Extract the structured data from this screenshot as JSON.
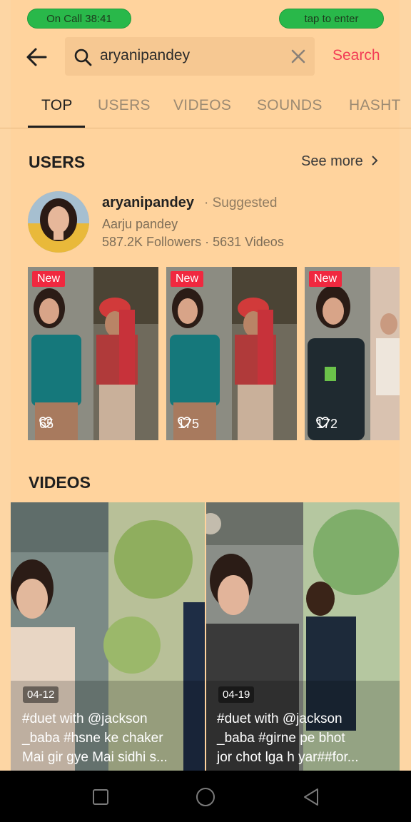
{
  "status": {
    "call_label": "On Call   38:41",
    "enter_label": "tap to enter"
  },
  "search": {
    "query": "aryanipandey",
    "button": "Search"
  },
  "tabs": [
    {
      "label": "TOP",
      "active": true
    },
    {
      "label": "USERS"
    },
    {
      "label": "VIDEOS"
    },
    {
      "label": "SOUNDS"
    },
    {
      "label": "HASHT"
    }
  ],
  "users": {
    "title": "USERS",
    "see_more": "See more",
    "user": {
      "username": "aryanipandey",
      "suggested": "· Suggested",
      "display_name": "Aarju pandey",
      "stats": "587.2K Followers · 5631 Videos"
    },
    "thumbs": [
      {
        "badge": "New",
        "likes": "65"
      },
      {
        "badge": "New",
        "likes": "175"
      },
      {
        "badge": "New",
        "likes": "172"
      }
    ]
  },
  "videos": {
    "title": "VIDEOS",
    "items": [
      {
        "date": "04-12",
        "caption": [
          "#duet with @jackson",
          "_baba #hsne ke chaker",
          "Mai gir gye Mai sidhi s..."
        ]
      },
      {
        "date": "04-19",
        "caption": [
          "#duet with @jackson",
          "_baba #girne pe bhot",
          "jor chot lga h yar##for..."
        ]
      }
    ]
  },
  "colors": {
    "accent": "#f23b55",
    "call_green": "#29b84a",
    "background": "#ffd39d"
  },
  "icons": [
    "back-arrow-icon",
    "search-icon",
    "clear-icon",
    "chevron-right-icon",
    "heart-icon",
    "recent-apps-icon",
    "home-icon",
    "back-icon"
  ]
}
